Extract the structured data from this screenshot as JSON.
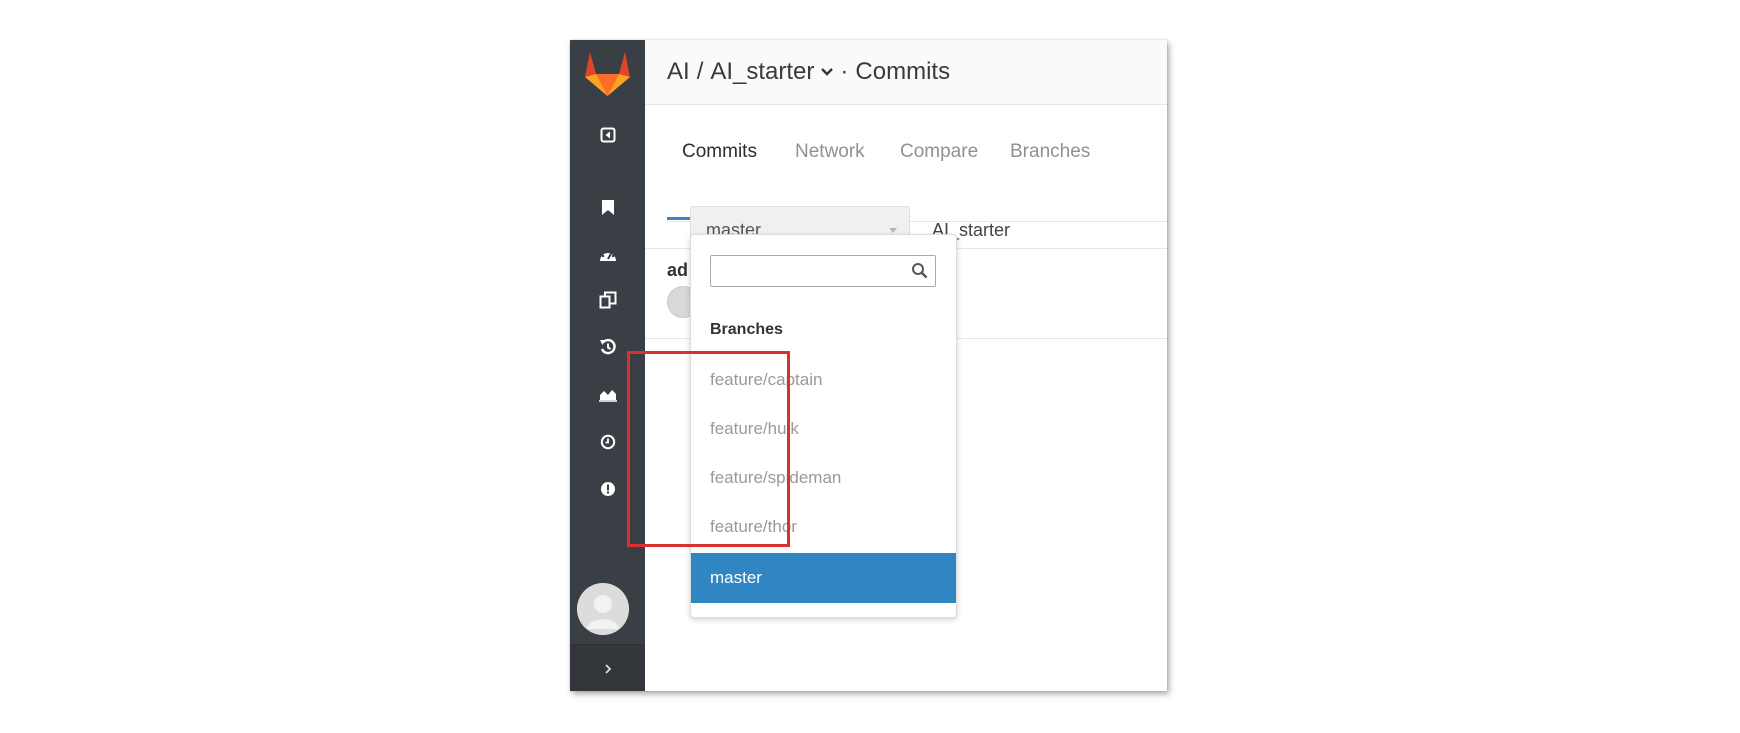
{
  "header": {
    "namespace": "AI",
    "separator": "/",
    "project": "AI_starter",
    "dot": "·",
    "section": "Commits"
  },
  "tabs": [
    {
      "label": "Commits",
      "active": true
    },
    {
      "label": "Network",
      "active": false
    },
    {
      "label": "Compare",
      "active": false
    },
    {
      "label": "Branches",
      "active": false
    }
  ],
  "branch_select": {
    "value": "master"
  },
  "path_label": "AI_starter",
  "commit_preview": {
    "author_partial": "ad"
  },
  "dropdown": {
    "search": {
      "value": "",
      "placeholder": ""
    },
    "header": "Branches",
    "items": [
      {
        "label": "feature/captain"
      },
      {
        "label": "feature/hulk"
      },
      {
        "label": "feature/spideman"
      },
      {
        "label": "feature/thor"
      },
      {
        "label": "master",
        "selected": true
      }
    ]
  },
  "sidebar": {
    "icons": [
      "collapse-icon",
      "bookmark-icon",
      "dashboard-icon",
      "files-icon",
      "history-icon",
      "graph-icon",
      "clock-icon",
      "issues-icon"
    ],
    "expand_icon": "chevron-right-icon"
  },
  "colors": {
    "sidebar_bg": "#3a3f45",
    "accent": "#2f86c2",
    "tab_underline": "#3b83c0",
    "highlight": "#d9312f",
    "logo": "#e24329"
  }
}
